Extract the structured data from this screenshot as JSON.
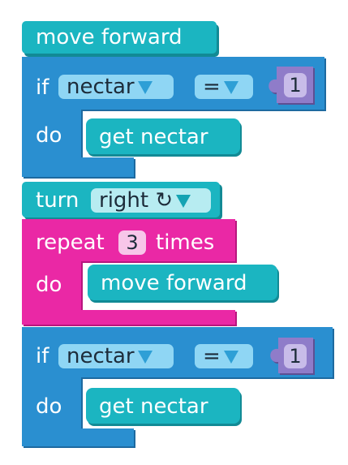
{
  "colors": {
    "motion": "#1bb5c1",
    "motion_dark": "#128a95",
    "logic": "#2a8fd0",
    "logic_dark": "#1d6aa0",
    "loop": "#ea28a5",
    "loop_dark": "#b8167e",
    "value": "#8f7cc9",
    "value_dark": "#5e4f93"
  },
  "blocks": {
    "move1": {
      "label": "move forward"
    },
    "if1": {
      "if_label": "if",
      "sensor": "nectar",
      "operator": "=",
      "value": "1",
      "do_label": "do",
      "action": "get nectar"
    },
    "turn": {
      "label": "turn",
      "direction": "right ↻"
    },
    "repeat": {
      "label": "repeat",
      "count": "3",
      "suffix": "times",
      "do_label": "do",
      "action": "move forward"
    },
    "if2": {
      "if_label": "if",
      "sensor": "nectar",
      "operator": "=",
      "value": "1",
      "do_label": "do",
      "action": "get nectar"
    }
  }
}
